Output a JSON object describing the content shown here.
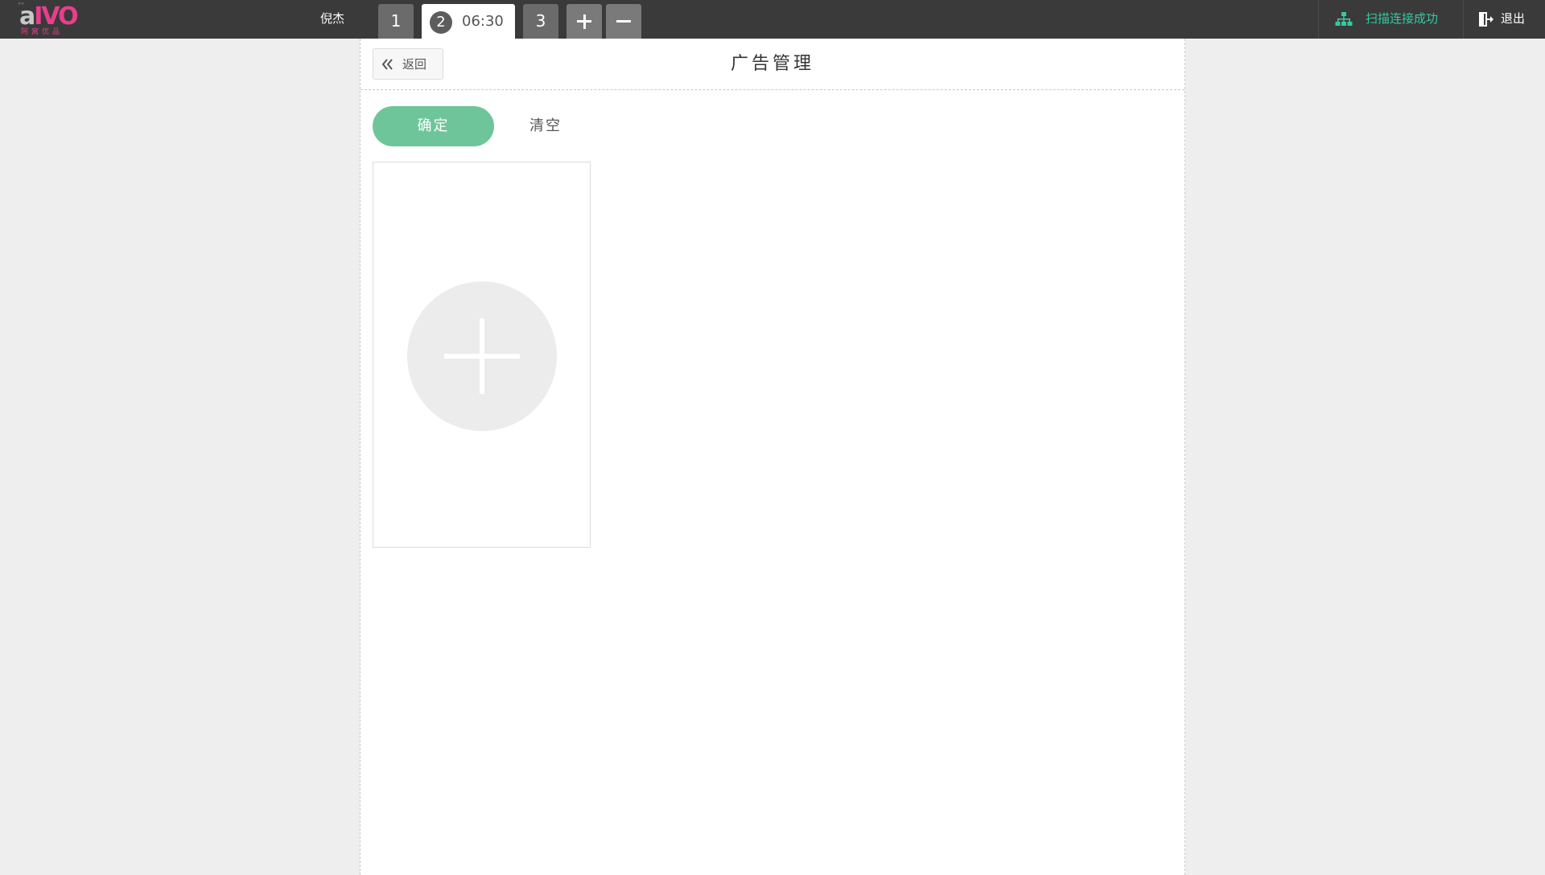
{
  "header": {
    "logo": {
      "word": "aIVO",
      "sub": "阿 窝 优 品"
    },
    "user_name": "倪杰",
    "tabs": [
      {
        "label": "1"
      },
      {
        "label": "2",
        "time": "06:30",
        "active": true
      },
      {
        "label": "3"
      }
    ],
    "add_tab_icon": "plus-icon",
    "remove_tab_icon": "minus-icon",
    "scan_status": {
      "icon": "network-icon",
      "label": "扫描连接成功",
      "color": "#35c9a0"
    },
    "logout": {
      "icon": "exit-icon",
      "label": "退出"
    }
  },
  "panel": {
    "back_button": {
      "icon": "double-chevron-left-icon",
      "label": "返回"
    },
    "title": "广告管理",
    "confirm_label": "确定",
    "confirm_color": "#6ec59a",
    "clear_label": "清空",
    "upload": {
      "icon": "add-circle-icon"
    }
  }
}
